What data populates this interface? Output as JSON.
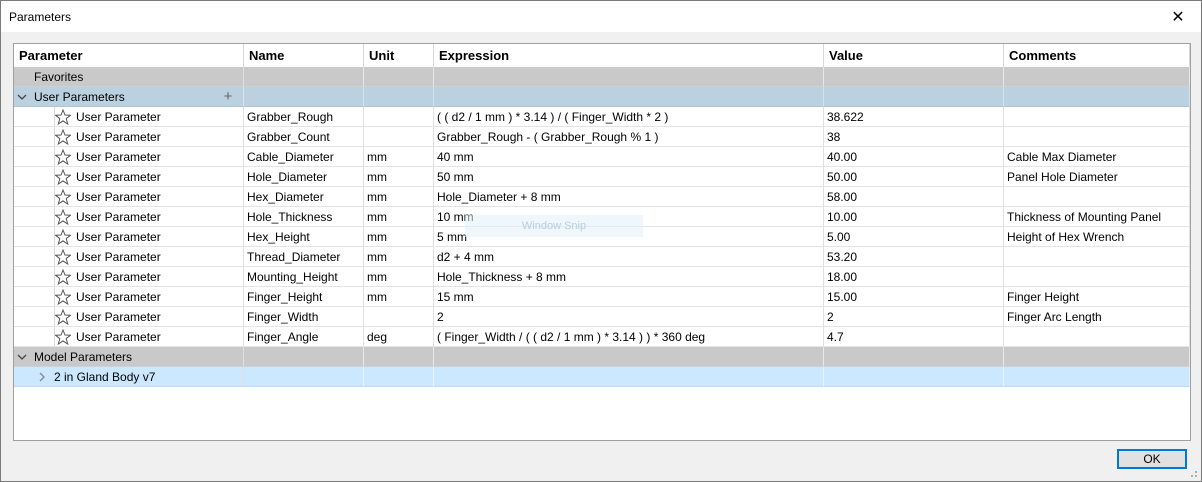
{
  "window": {
    "title": "Parameters",
    "close_glyph": "✕"
  },
  "columns": [
    "Parameter",
    "Name",
    "Unit",
    "Expression",
    "Value",
    "Comments"
  ],
  "groups": {
    "favorites": "Favorites",
    "user": "User Parameters",
    "model": "Model Parameters",
    "model_child": "2 in Gland Body v7"
  },
  "user_parameters": [
    {
      "type": "User Parameter",
      "name": "Grabber_Rough",
      "unit": "",
      "expression": "( ( d2 / 1 mm ) * 3.14 ) / ( Finger_Width * 2 )",
      "value": "38.622",
      "comment": ""
    },
    {
      "type": "User Parameter",
      "name": "Grabber_Count",
      "unit": "",
      "expression": "Grabber_Rough - ( Grabber_Rough % 1 )",
      "value": "38",
      "comment": ""
    },
    {
      "type": "User Parameter",
      "name": "Cable_Diameter",
      "unit": "mm",
      "expression": "40 mm",
      "value": "40.00",
      "comment": "Cable Max Diameter"
    },
    {
      "type": "User Parameter",
      "name": "Hole_Diameter",
      "unit": "mm",
      "expression": "50 mm",
      "value": "50.00",
      "comment": "Panel Hole Diameter"
    },
    {
      "type": "User Parameter",
      "name": "Hex_Diameter",
      "unit": "mm",
      "expression": "Hole_Diameter + 8 mm",
      "value": "58.00",
      "comment": ""
    },
    {
      "type": "User Parameter",
      "name": "Hole_Thickness",
      "unit": "mm",
      "expression": "10 mm",
      "value": "10.00",
      "comment": "Thickness of Mounting Panel"
    },
    {
      "type": "User Parameter",
      "name": "Hex_Height",
      "unit": "mm",
      "expression": "5 mm",
      "value": "5.00",
      "comment": "Height of Hex Wrench"
    },
    {
      "type": "User Parameter",
      "name": "Thread_Diameter",
      "unit": "mm",
      "expression": "d2 + 4 mm",
      "value": "53.20",
      "comment": ""
    },
    {
      "type": "User Parameter",
      "name": "Mounting_Height",
      "unit": "mm",
      "expression": "Hole_Thickness + 8 mm",
      "value": "18.00",
      "comment": ""
    },
    {
      "type": "User Parameter",
      "name": "Finger_Height",
      "unit": "mm",
      "expression": "15 mm",
      "value": "15.00",
      "comment": "Finger Height"
    },
    {
      "type": "User Parameter",
      "name": "Finger_Width",
      "unit": "",
      "expression": "2",
      "value": "2",
      "comment": "Finger Arc Length"
    },
    {
      "type": "User Parameter",
      "name": "Finger_Angle",
      "unit": "deg",
      "expression": "( Finger_Width / ( ( d2 / 1 mm ) * 3.14 ) ) * 360 deg",
      "value": "4.7",
      "comment": ""
    }
  ],
  "overlay": {
    "snip_label": "Window Snip"
  },
  "buttons": {
    "ok": "OK"
  },
  "icons": {
    "close": "close-icon",
    "expand": "chevron-down-icon",
    "collapsed": "chevron-right-icon",
    "add": "plus-icon",
    "favorite": "star-outline-icon"
  }
}
